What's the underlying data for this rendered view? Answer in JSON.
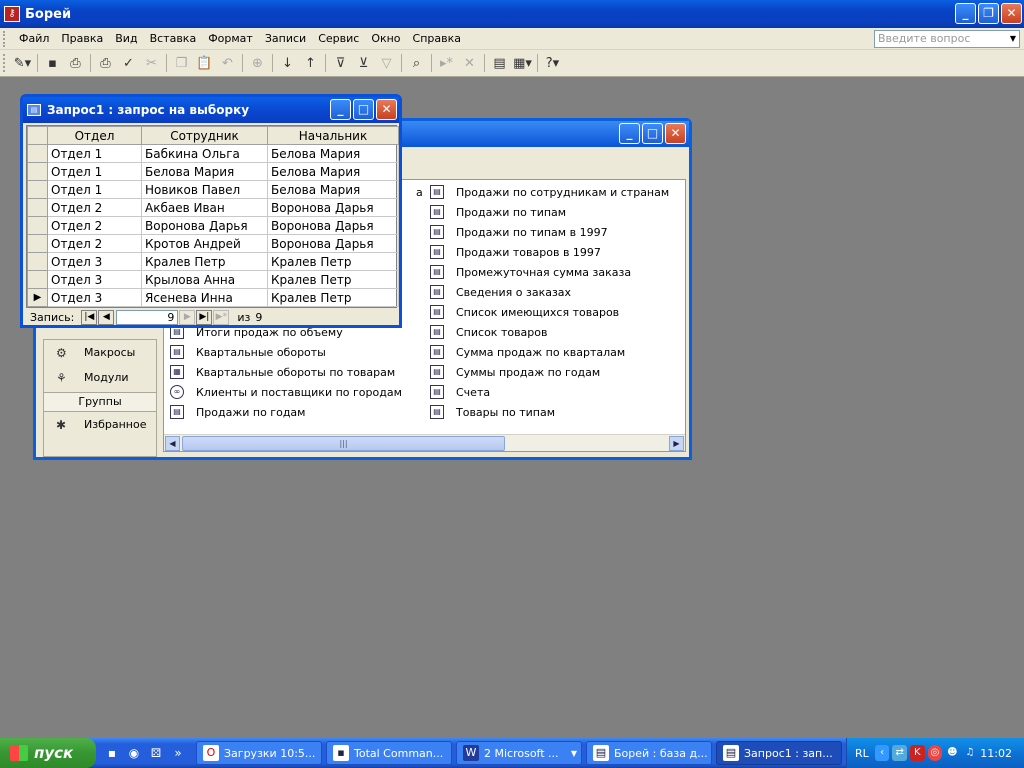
{
  "app": {
    "title": "Борей",
    "icon": "key-icon",
    "buttons": [
      "minimize",
      "restore",
      "close"
    ]
  },
  "menu": {
    "items": [
      "Файл",
      "Правка",
      "Вид",
      "Вставка",
      "Формат",
      "Записи",
      "Сервис",
      "Окно",
      "Справка"
    ],
    "help_placeholder": "Введите вопрос"
  },
  "toolbar": {
    "icons": [
      "design-icon",
      "save-icon",
      "print-preview-icon",
      "print-icon",
      "spellcheck-icon",
      "cut-icon",
      "copy-icon",
      "paste-icon",
      "undo-icon",
      "hyperlink-icon",
      "sort-asc-icon",
      "sort-desc-icon",
      "filter-selection-icon",
      "filter-form-icon",
      "apply-filter-icon",
      "find-icon",
      "new-record-icon",
      "delete-record-icon",
      "database-window-icon",
      "new-object-icon",
      "help-icon"
    ]
  },
  "db_window": {
    "objects": [
      {
        "label": "Макросы",
        "icon": "macro-icon"
      },
      {
        "label": "Модули",
        "icon": "module-icon"
      }
    ],
    "groups_header": "Группы",
    "favorites": {
      "label": "Избранное",
      "icon": "favorites-icon"
    },
    "list_col1": [
      {
        "label": "а",
        "partial": true
      },
      {
        "label": "Итоги продаж по объему"
      },
      {
        "label": "Квартальные обороты"
      },
      {
        "label": "Квартальные обороты по товарам"
      },
      {
        "label": "Клиенты и поставщики по городам"
      },
      {
        "label": "Продажи по годам"
      }
    ],
    "list_col2": [
      "Продажи по сотрудникам и странам",
      "Продажи по типам",
      "Продажи по типам в 1997",
      "Продажи товаров в 1997",
      "Промежуточная сумма заказа",
      "Сведения о заказах",
      "Список имеющихся товаров",
      "Список товаров",
      "Сумма продаж по кварталам",
      "Суммы продаж по годам",
      "Счета",
      "Товары по типам"
    ]
  },
  "query_window": {
    "title": "Запрос1 : запрос на выборку",
    "columns": [
      "Отдел",
      "Сотрудник",
      "Начальник"
    ],
    "rows": [
      [
        "Отдел 1",
        "Бабкина Ольга",
        "Белова Мария"
      ],
      [
        "Отдел 1",
        "Белова Мария",
        "Белова Мария"
      ],
      [
        "Отдел 1",
        "Новиков Павел",
        "Белова Мария"
      ],
      [
        "Отдел 2",
        "Акбаев Иван",
        "Воронова Дарья"
      ],
      [
        "Отдел 2",
        "Воронова Дарья",
        "Воронова Дарья"
      ],
      [
        "Отдел 2",
        "Кротов Андрей",
        "Воронова Дарья"
      ],
      [
        "Отдел 3",
        "Кралев Петр",
        "Кралев Петр"
      ],
      [
        "Отдел 3",
        "Крылова Анна",
        "Кралев Петр"
      ],
      [
        "Отдел 3",
        "Ясенева Инна",
        "Кралев Петр"
      ]
    ],
    "current_row_marker": "▶",
    "nav": {
      "label": "Запись:",
      "current": "9",
      "of_label": "из",
      "total": "9"
    }
  },
  "taskbar": {
    "start_label": "пуск",
    "quicklaunch_more": "»",
    "tasks": [
      {
        "label": "Загрузки 10:5...",
        "icon": "opera-icon"
      },
      {
        "label": "Total Comman...",
        "icon": "floppy-icon"
      },
      {
        "label": "2 Microsoft ...",
        "icon": "word-icon"
      },
      {
        "label": "Борей : база д...",
        "icon": "access-db-icon"
      },
      {
        "label": "Запрос1 : зап...",
        "icon": "access-query-icon",
        "active": true
      }
    ],
    "tray": {
      "lang": "RL",
      "clock": "11:02"
    }
  }
}
